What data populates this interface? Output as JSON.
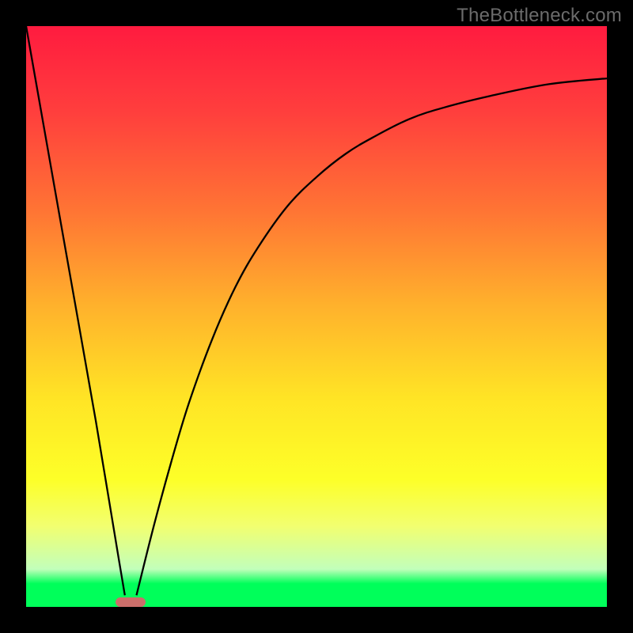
{
  "watermark": "TheBottleneck.com",
  "colors": {
    "frame": "#000000",
    "gradient_top": "#ff1b3f",
    "gradient_bottom": "#00ff5a",
    "curve": "#000000",
    "marker": "#cb6e6a",
    "watermark_text": "#6b6b6b"
  },
  "chart_data": {
    "type": "line",
    "title": "",
    "xlabel": "",
    "ylabel": "",
    "xlim": [
      0,
      100
    ],
    "ylim": [
      0,
      100
    ],
    "grid": false,
    "legend": null,
    "description": "V-shaped bottleneck curve. x is relative performance/balance position (0–100), y is bottleneck severity (0 = green/good at bottom, 100 = red/bad at top). Left branch is a steep straight descent; right branch is a saturating rise.",
    "marker_x": 18,
    "series": [
      {
        "name": "left-branch",
        "x": [
          0,
          3,
          6,
          9,
          12,
          14,
          16,
          17
        ],
        "values": [
          100,
          83,
          66,
          49,
          32,
          20,
          8,
          2
        ]
      },
      {
        "name": "right-branch",
        "x": [
          19,
          22,
          25,
          28,
          32,
          36,
          40,
          45,
          50,
          55,
          60,
          66,
          72,
          80,
          90,
          100
        ],
        "values": [
          2,
          14,
          25,
          35,
          46,
          55,
          62,
          69,
          74,
          78,
          81,
          84,
          86,
          88,
          90,
          91
        ]
      }
    ]
  }
}
